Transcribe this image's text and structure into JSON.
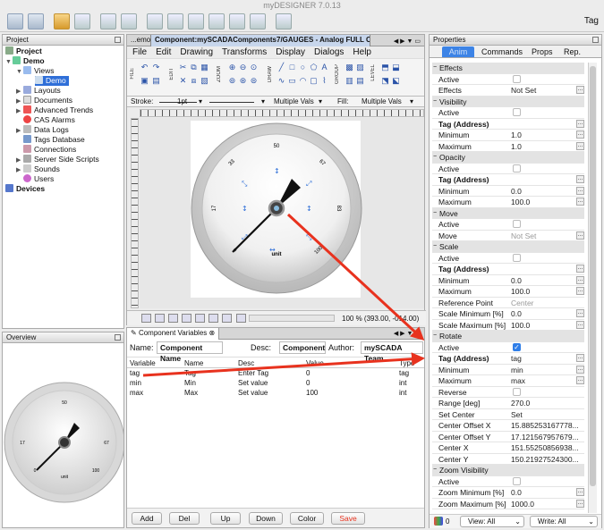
{
  "window": {
    "title": "myDESIGNER 7.0.13",
    "tag_button": "Tag"
  },
  "toolbar": {
    "icons": [
      "save-icon",
      "save-all-icon",
      "undo-icon",
      "redo-icon",
      "copy-icon",
      "delete-icon",
      "run-icon",
      "deploy-icon",
      "upload-icon",
      "download-icon",
      "check-icon",
      "clear-icon",
      "monitor-icon"
    ]
  },
  "project": {
    "header": "Project",
    "root": "Project",
    "items": [
      {
        "label": "Demo",
        "level": 1,
        "bold": true
      },
      {
        "label": "Views",
        "level": 2
      },
      {
        "label": "Demo",
        "level": 3,
        "selected": true
      },
      {
        "label": "Layouts",
        "level": 2
      },
      {
        "label": "Documents",
        "level": 2
      },
      {
        "label": "Advanced Trends",
        "level": 2
      },
      {
        "label": "CAS Alarms",
        "level": 2
      },
      {
        "label": "Data Logs",
        "level": 2
      },
      {
        "label": "Tags Database",
        "level": 2
      },
      {
        "label": "Connections",
        "level": 2
      },
      {
        "label": "Server Side Scripts",
        "level": 2
      },
      {
        "label": "Sounds",
        "level": 2
      },
      {
        "label": "Users",
        "level": 2
      },
      {
        "label": "Devices",
        "level": 1,
        "bold": true
      }
    ]
  },
  "overview": {
    "header": "Overview"
  },
  "editor": {
    "tab_prev": "...emo",
    "tab_active": "Component:mySCADAComponents7/GAUGES - Analog FULL Color",
    "menu": [
      "File",
      "Edit",
      "Drawing",
      "Transforms",
      "Display",
      "Dialogs",
      "Help"
    ],
    "stroke_label": "Stroke:",
    "stroke_width": "1pt",
    "multi1": "Multiple Vals",
    "fill_label": "Fill:",
    "multi2": "Multiple Vals",
    "group_labels": [
      "FILE",
      "EDIT",
      "ZOOM",
      "DRAW",
      "GROUP",
      "LEVEL"
    ],
    "zoom_status": "100 % (393.00, -014.00)"
  },
  "gauge": {
    "ticks": [
      "0",
      "17",
      "33",
      "50",
      "67",
      "83",
      "100"
    ],
    "unit": "unit",
    "needle_angle": 135
  },
  "component_variables": {
    "tab": "Component Variables",
    "name_label": "Name:",
    "name_value": "Component Name",
    "desc_label": "Desc:",
    "desc_value": "Component",
    "author_label": "Author:",
    "author_value": "mySCADA Team",
    "columns": [
      "Variable",
      "Name",
      "Desc",
      "Value",
      "Type"
    ],
    "rows": [
      [
        "tag",
        "Tag",
        "Enter Tag",
        "0",
        "tag"
      ],
      [
        "min",
        "Min",
        "Set value",
        "0",
        "int"
      ],
      [
        "max",
        "Max",
        "Set value",
        "100",
        "int"
      ]
    ],
    "buttons": [
      "Add",
      "Del",
      "Up",
      "Down",
      "Color",
      "Save"
    ]
  },
  "properties": {
    "header": "Properties",
    "tabs": [
      "Anim",
      "Commands",
      "Props",
      "Rep."
    ],
    "rows": [
      {
        "type": "section",
        "label": "Effects"
      },
      {
        "label": "Active",
        "check": false
      },
      {
        "label": "Effects",
        "value": "Not Set",
        "dots": true
      },
      {
        "type": "section",
        "label": "Visibility"
      },
      {
        "label": "Active",
        "check": false
      },
      {
        "label": "Tag (Address)",
        "bold": true,
        "dots": true
      },
      {
        "label": "Minimum",
        "value": "1.0",
        "dots": true
      },
      {
        "label": "Maximum",
        "value": "1.0",
        "dots": true
      },
      {
        "type": "section",
        "label": "Opacity"
      },
      {
        "label": "Active",
        "check": false
      },
      {
        "label": "Tag (Address)",
        "bold": true,
        "dots": true
      },
      {
        "label": "Minimum",
        "value": "0.0",
        "dots": true
      },
      {
        "label": "Maximum",
        "value": "100.0",
        "dots": true
      },
      {
        "type": "section",
        "label": "Move"
      },
      {
        "label": "Active",
        "check": false
      },
      {
        "label": "Move",
        "value": "Not Set",
        "grey": true,
        "dots": true
      },
      {
        "type": "section",
        "label": "Scale"
      },
      {
        "label": "Active",
        "check": false
      },
      {
        "label": "Tag (Address)",
        "bold": true,
        "dots": true
      },
      {
        "label": "Minimum",
        "value": "0.0",
        "dots": true
      },
      {
        "label": "Maximum",
        "value": "100.0",
        "dots": true
      },
      {
        "label": "Reference Point",
        "value": "Center",
        "grey": true
      },
      {
        "label": "Scale Minimum [%]",
        "value": "0.0",
        "dots": true
      },
      {
        "label": "Scale Maximum [%]",
        "value": "100.0",
        "dots": true
      },
      {
        "type": "section",
        "label": "Rotate"
      },
      {
        "label": "Active",
        "check": true
      },
      {
        "label": "Tag (Address)",
        "bold": true,
        "value": "tag",
        "dots": true
      },
      {
        "label": "Minimum",
        "value": "min",
        "dots": true
      },
      {
        "label": "Maximum",
        "value": "max",
        "dots": true
      },
      {
        "label": "Reverse",
        "check": false
      },
      {
        "label": "Range [deg]",
        "value": "270.0"
      },
      {
        "label": "Set Center",
        "value": "Set"
      },
      {
        "label": "Center Offset X",
        "value": "15.885253167778..."
      },
      {
        "label": "Center Offset Y",
        "value": "17.121567957679..."
      },
      {
        "label": "Center X",
        "value": "151.55250856938..."
      },
      {
        "label": "Center Y",
        "value": "150.21927524300..."
      },
      {
        "type": "section",
        "label": "Zoom Visibility"
      },
      {
        "label": "Active",
        "check": false
      },
      {
        "label": "Zoom Minimum [%]",
        "value": "0.0",
        "dots": true
      },
      {
        "label": "Zoom Maximum [%]",
        "value": "1000.0",
        "dots": true
      }
    ],
    "footer": {
      "count": "0",
      "view": "View: All",
      "write": "Write: All"
    }
  },
  "colors": {
    "accent": "#2f7ee8",
    "arrow": "#e8321e",
    "section": "#e3e3e3"
  }
}
